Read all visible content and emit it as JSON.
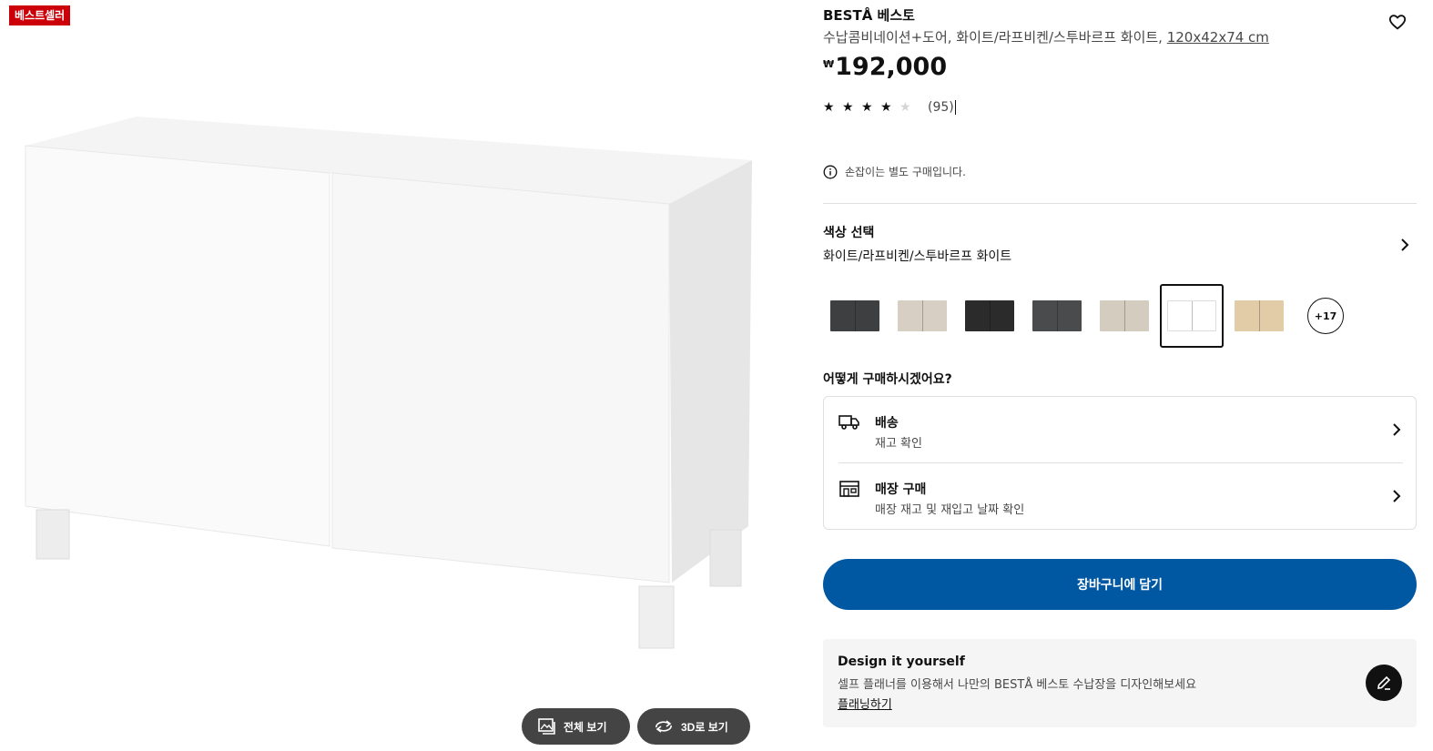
{
  "gallery": {
    "badge": "베스트셀러",
    "view_all_label": "전체 보기",
    "view_3d_label": "3D로 보기"
  },
  "product": {
    "name": "BESTÅ 베스토",
    "description": "수납콤비네이션+도어, 화이트/라프비켄/스투바르프 화이트, ",
    "dimensions": "120x42x74 cm",
    "currency": "₩",
    "price": "192,000",
    "rating": 4,
    "rating_max": 5,
    "review_count": "(95)",
    "handle_note": "손잡이는 별도 구매입니다."
  },
  "color": {
    "heading": "색상 선택",
    "selected_name": "화이트/라프비켄/스투바르프 화이트",
    "swatches": [
      "#3d3f41",
      "#d8cfc4",
      "#2b2b2b",
      "#4a4b4d",
      "#d5ccc0",
      "#ffffff",
      "#e2cba7"
    ],
    "more_label": "+17"
  },
  "purchase": {
    "heading": "어떻게 구매하시겠어요?",
    "delivery_label": "배송",
    "delivery_sub": "재고 확인",
    "store_label": "매장 구매",
    "store_sub": "매장 재고 및 재입고 날짜 확인"
  },
  "cart": {
    "label": "장바구니에 담기"
  },
  "diy": {
    "heading": "Design it yourself",
    "text": "셀프 플래너를 이용해서 나만의 BESTÅ 베스토 수납장을 디자인해보세요",
    "link": "플래닝하기"
  },
  "colors": {
    "accent": "#0058a3",
    "badge": "#cc0008"
  },
  "icons": [
    "heart-icon",
    "info-icon",
    "chevron-right-icon",
    "truck-icon",
    "store-icon",
    "image-gallery-icon",
    "rotate-3d-icon",
    "pencil-icon"
  ]
}
